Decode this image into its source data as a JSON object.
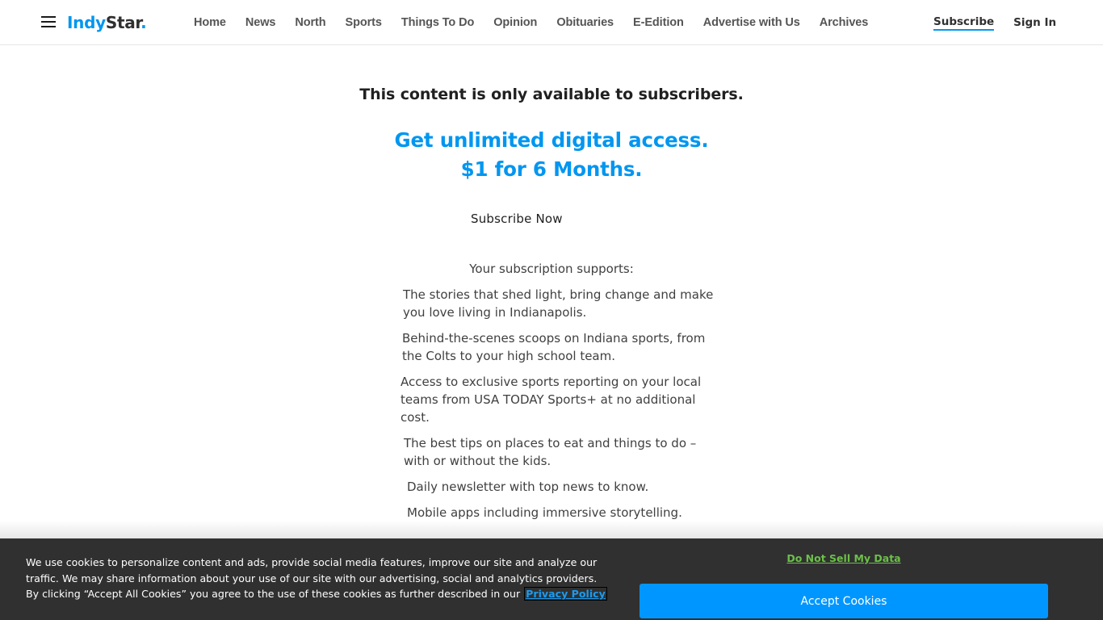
{
  "header": {
    "logo": {
      "part1": "Indy",
      "part2": "Star",
      "dot": "."
    },
    "menu_icon": "hamburger-menu-icon",
    "nav": [
      {
        "label": "Home"
      },
      {
        "label": "News"
      },
      {
        "label": "North"
      },
      {
        "label": "Sports"
      },
      {
        "label": "Things To Do"
      },
      {
        "label": "Opinion"
      },
      {
        "label": "Obituaries"
      },
      {
        "label": "E-Edition"
      },
      {
        "label": "Advertise with Us"
      },
      {
        "label": "Archives"
      }
    ],
    "subscribe_label": "Subscribe",
    "sign_in_label": "Sign In"
  },
  "paywall": {
    "title": "This content is only available to subscribers.",
    "offer_line1": "Get unlimited digital access.",
    "offer_line2": "$1 for 6 Months.",
    "subscribe_now_label": "Subscribe Now",
    "supports_title": "Your subscription supports:",
    "benefits": [
      "The stories that shed light, bring change and make you love living in Indianapolis.",
      "Behind-the-scenes scoops on Indiana sports, from the Colts to your high school team.",
      "Access to exclusive sports reporting on your local teams from USA TODAY Sports+ at no additional cost.",
      "The best tips on places to eat and things to do – with or without the kids.",
      "Daily newsletter with top news to know.",
      "Mobile apps including immersive storytelling."
    ]
  },
  "cookie_banner": {
    "text": "We use cookies to personalize content and ads, provide social media features, improve our site and analyze our traffic. We may share information about your use of our site with our advertising, social and analytics providers. By clicking “Accept All Cookies” you agree to the use of these cookies as further described in our",
    "privacy_link_label": "Privacy Policy",
    "do_not_sell_label": "Do Not Sell My Data",
    "accept_label": "Accept Cookies"
  },
  "colors": {
    "brand_blue": "#0096f0",
    "accept_button": "#0096ff",
    "banner_bg": "#303030",
    "do_not_sell_green": "#6cc04a"
  }
}
